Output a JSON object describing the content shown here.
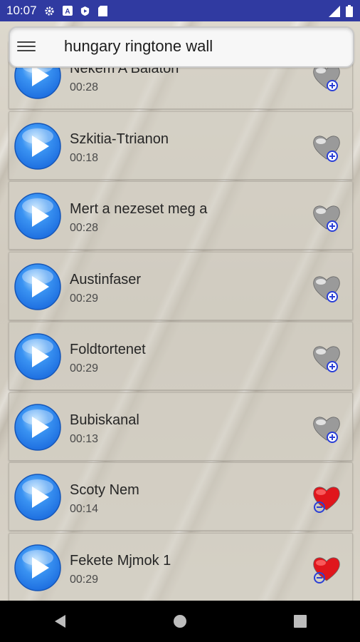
{
  "status": {
    "time": "10:07",
    "icons": [
      "gear-icon",
      "a-icon",
      "shield-play-icon",
      "sd-card-icon"
    ],
    "right_icons": [
      "signal-icon",
      "battery-icon"
    ]
  },
  "header": {
    "title": "hungary ringtone wall",
    "menu_icon": "hamburger-menu-icon"
  },
  "tracks": [
    {
      "name": "Nekem A Balaton",
      "duration": "00:28",
      "favorite": false
    },
    {
      "name": "Szkitia-Ttrianon",
      "duration": "00:18",
      "favorite": false
    },
    {
      "name": "Mert a nezeset meg a",
      "duration": "00:28",
      "favorite": false
    },
    {
      "name": "Austinfaser",
      "duration": "00:29",
      "favorite": false
    },
    {
      "name": "Foldtortenet",
      "duration": "00:29",
      "favorite": false
    },
    {
      "name": "Bubiskanal",
      "duration": "00:13",
      "favorite": false
    },
    {
      "name": "Scoty Nem",
      "duration": "00:14",
      "favorite": true
    },
    {
      "name": "Fekete Mjmok 1",
      "duration": "00:29",
      "favorite": true
    }
  ],
  "colors": {
    "status_bar": "#303aa1",
    "play_blue": "#1e6fe0",
    "heart_red": "#e0161c",
    "heart_grey": "#9a9a9a"
  },
  "nav": [
    "back-icon",
    "home-icon",
    "recents-icon"
  ]
}
